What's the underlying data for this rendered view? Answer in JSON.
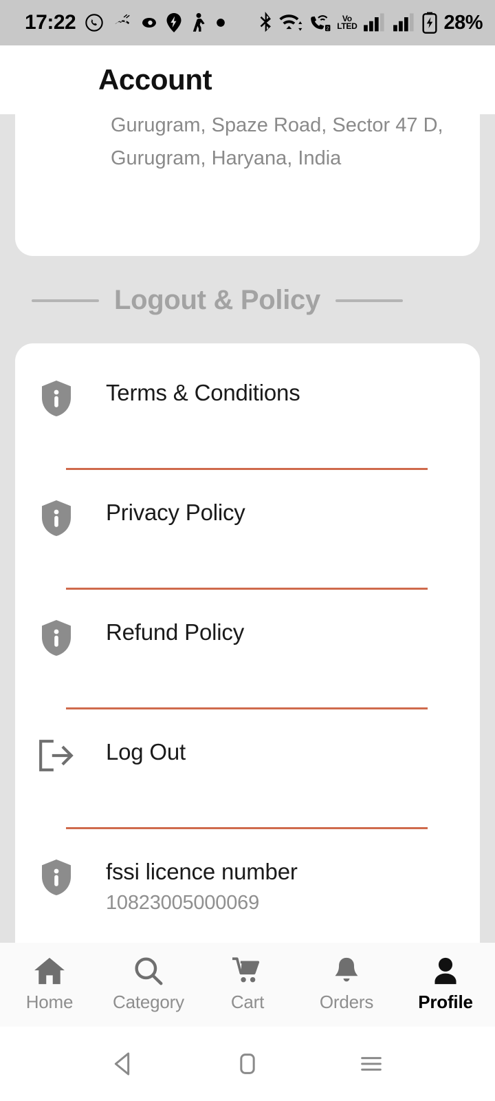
{
  "status_bar": {
    "time": "17:22",
    "left_icons": [
      "whatsapp-icon",
      "missed-call-icon",
      "eye-icon",
      "location-pin-icon",
      "person-walking-icon",
      "dot-icon"
    ],
    "right_icons": [
      "bluetooth-icon",
      "wifi-icon",
      "wifi-calling-icon",
      "volte-icon",
      "signal-bars-sim1-icon",
      "signal-bars-sim2-icon",
      "battery-charging-icon"
    ],
    "volte_line1": "Vo",
    "volte_line2": "LTED",
    "battery_percent": "28%"
  },
  "header": {
    "title": "Account"
  },
  "address_card": {
    "line1": "Gurugram, Spaze Road, Sector 47 D,",
    "line2": "Gurugram, Haryana, India"
  },
  "section": {
    "title": "Logout & Policy"
  },
  "policy_items": [
    {
      "icon": "shield-info-icon",
      "label": "Terms & Conditions",
      "sub": ""
    },
    {
      "icon": "shield-info-icon",
      "label": "Privacy Policy",
      "sub": ""
    },
    {
      "icon": "shield-info-icon",
      "label": "Refund Policy",
      "sub": ""
    },
    {
      "icon": "logout-icon",
      "label": "Log Out",
      "sub": ""
    },
    {
      "icon": "shield-info-icon",
      "label": "fssi licence number",
      "sub": "10823005000069"
    }
  ],
  "bottom_nav": [
    {
      "icon": "home-icon",
      "label": "Home",
      "active": false
    },
    {
      "icon": "search-icon",
      "label": "Category",
      "active": false
    },
    {
      "icon": "cart-icon",
      "label": "Cart",
      "active": false
    },
    {
      "icon": "bell-icon",
      "label": "Orders",
      "active": false
    },
    {
      "icon": "person-icon",
      "label": "Profile",
      "active": true
    }
  ],
  "system_nav": [
    "back-icon",
    "home-square-icon",
    "recents-icon"
  ],
  "colors": {
    "page_background": "#e2e2e2",
    "card_background": "#ffffff",
    "divider_accent": "#cf6a4c",
    "muted_text": "#8f8f8f",
    "status_bar_background": "#c8c8c8"
  }
}
